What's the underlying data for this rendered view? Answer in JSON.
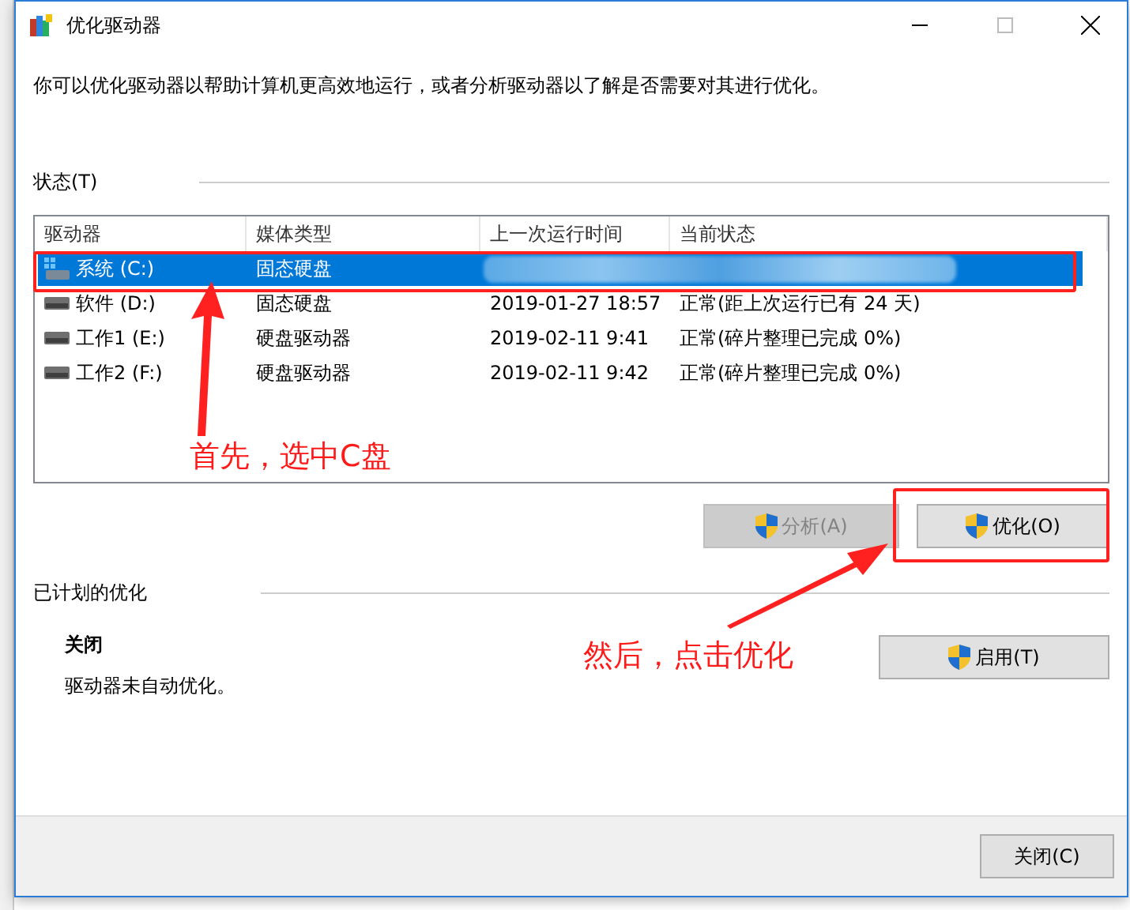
{
  "window": {
    "title": "优化驱动器"
  },
  "description": "你可以优化驱动器以帮助计算机更高效地运行，或者分析驱动器以了解是否需要对其进行优化。",
  "status_section": {
    "label": "状态(T)"
  },
  "drives": {
    "columns": [
      "驱动器",
      "媒体类型",
      "上一次运行时间",
      "当前状态"
    ],
    "rows": [
      {
        "kind": "system",
        "name": "系统 (C:)",
        "media": "固态硬盘",
        "selected": true
      },
      {
        "kind": "disk",
        "name": "软件 (D:)",
        "media": "固态硬盘",
        "last_run": "2019-01-27 18:57",
        "status": "正常(距上次运行已有 24 天)",
        "selected": false
      },
      {
        "kind": "disk",
        "name": "工作1 (E:)",
        "media": "硬盘驱动器",
        "last_run": "2019-02-11 9:41",
        "status": "正常(碎片整理已完成 0%)",
        "selected": false
      },
      {
        "kind": "disk",
        "name": "工作2 (F:)",
        "media": "硬盘驱动器",
        "last_run": "2019-02-11 9:42",
        "status": "正常(碎片整理已完成 0%)",
        "selected": false
      }
    ]
  },
  "actions": [
    {
      "label": "分析(A)",
      "disabled": true
    },
    {
      "label": "优化(O)",
      "disabled": false
    }
  ],
  "schedule": {
    "heading": "已计划的优化",
    "state": "关闭",
    "note": "驱动器未自动优化。",
    "button": "启用(T)"
  },
  "footer": {
    "close": "关闭(C)"
  },
  "annotations": [
    {
      "text": "首先，选中C盘"
    },
    {
      "text": "然后，点击优化"
    }
  ]
}
